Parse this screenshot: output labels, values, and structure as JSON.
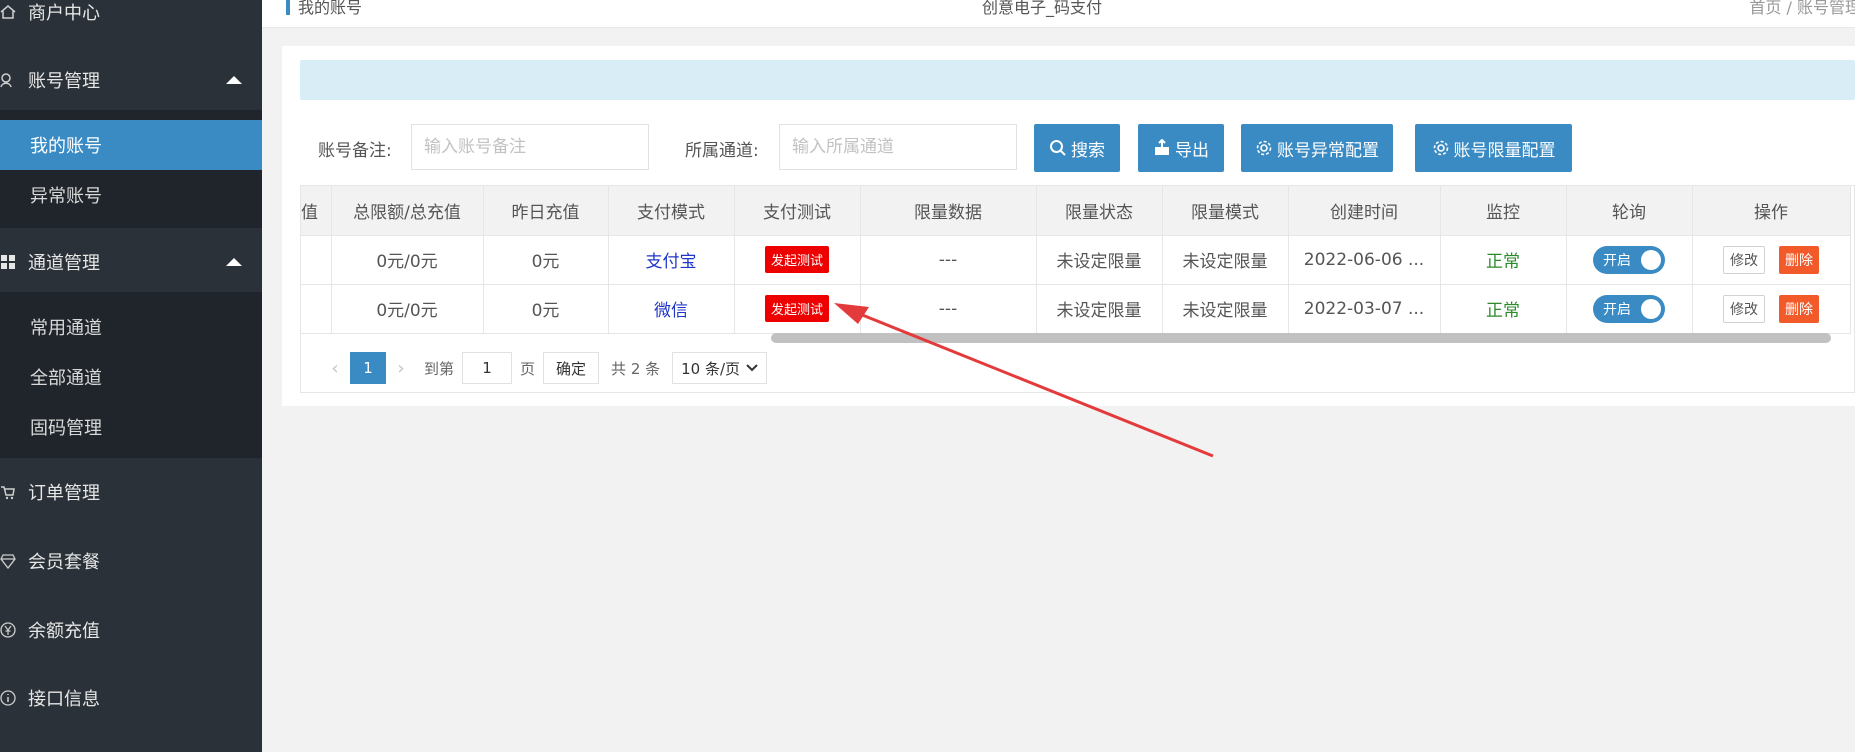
{
  "sidebar": {
    "top_item": "商户中心",
    "groups": [
      {
        "label": "账号管理",
        "icon": "account-icon",
        "children": [
          "我的账号",
          "异常账号"
        ],
        "active_child": 0
      },
      {
        "label": "通道管理",
        "icon": "grid-icon",
        "children": [
          "常用通道",
          "全部通道",
          "固码管理"
        ]
      }
    ],
    "items": [
      {
        "label": "订单管理",
        "icon": "cart-icon"
      },
      {
        "label": "会员套餐",
        "icon": "diamond-icon"
      },
      {
        "label": "余额充值",
        "icon": "yen-icon"
      },
      {
        "label": "接口信息",
        "icon": "info-icon"
      }
    ]
  },
  "header": {
    "page_title": "我的账号",
    "site_name": "创意电子_码支付",
    "breadcrumb": "首页  /  账号管理"
  },
  "filters": {
    "remark_label": "账号备注:",
    "remark_placeholder": "输入账号备注",
    "channel_label": "所属通道:",
    "channel_placeholder": "输入所属通道",
    "search_btn": "搜索",
    "export_btn": "导出",
    "abnormal_config_btn": "账号异常配置",
    "limit_config_btn": "账号限量配置"
  },
  "table": {
    "headers": [
      "值",
      "总限额/总充值",
      "昨日充值",
      "支付模式",
      "支付测试",
      "限量数据",
      "限量状态",
      "限量模式",
      "创建时间",
      "监控",
      "轮询",
      "操作"
    ],
    "rows": [
      {
        "total": "0元/0元",
        "yesterday": "0元",
        "mode": "支付宝",
        "test": "发起测试",
        "limit_data": "---",
        "limit_status": "未设定限量",
        "limit_mode": "未设定限量",
        "created": "2022-06-06 ...",
        "monitor": "正常",
        "poll": "开启",
        "edit": "修改",
        "delete": "删除"
      },
      {
        "total": "0元/0元",
        "yesterday": "0元",
        "mode": "微信",
        "test": "发起测试",
        "limit_data": "---",
        "limit_status": "未设定限量",
        "limit_mode": "未设定限量",
        "created": "2022-03-07 ...",
        "monitor": "正常",
        "poll": "开启",
        "edit": "修改",
        "delete": "删除"
      }
    ]
  },
  "pagination": {
    "current": "1",
    "goto_label": "到第",
    "goto_value": "1",
    "page_label": "页",
    "confirm": "确定",
    "total": "共 2 条",
    "page_size": "10 条/页"
  },
  "colors": {
    "sidebar_bg": "#2a3138",
    "primary": "#3a8bc4",
    "danger_test": "#ee0000",
    "delete": "#f25a2a",
    "annotation_arrow": "#e33b3b"
  }
}
